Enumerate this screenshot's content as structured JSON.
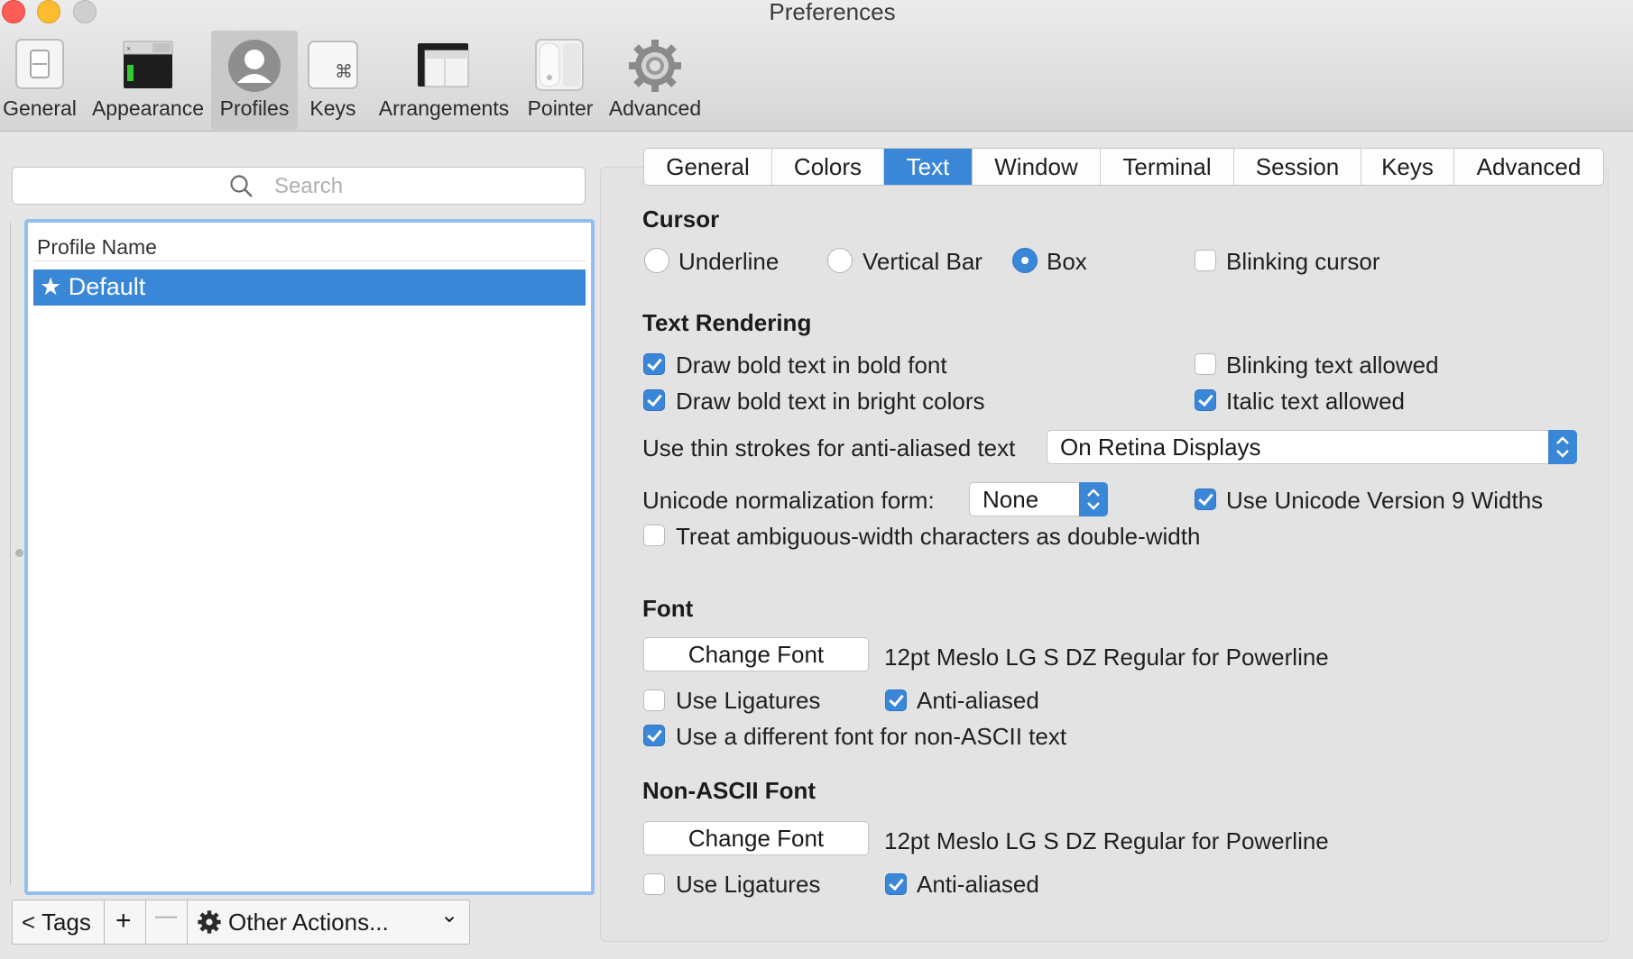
{
  "window": {
    "title": "Preferences"
  },
  "toolbar": {
    "items": [
      {
        "label": "General"
      },
      {
        "label": "Appearance"
      },
      {
        "label": "Profiles"
      },
      {
        "label": "Keys"
      },
      {
        "label": "Arrangements"
      },
      {
        "label": "Pointer"
      },
      {
        "label": "Advanced"
      }
    ],
    "selected": "Profiles"
  },
  "sidebar": {
    "search_placeholder": "Search",
    "table_header": "Profile Name",
    "profiles": [
      {
        "label": "★ Default",
        "selected": true
      }
    ],
    "bottom": {
      "tags": "< Tags",
      "add": "+",
      "remove": "—",
      "other_actions": "Other Actions...",
      "dropdown": "⌄"
    }
  },
  "tabs": [
    {
      "label": "General"
    },
    {
      "label": "Colors"
    },
    {
      "label": "Text",
      "active": true
    },
    {
      "label": "Window"
    },
    {
      "label": "Terminal"
    },
    {
      "label": "Session"
    },
    {
      "label": "Keys"
    },
    {
      "label": "Advanced"
    }
  ],
  "cursor": {
    "title": "Cursor",
    "options": {
      "underline": "Underline",
      "vertical_bar": "Vertical Bar",
      "box": "Box"
    },
    "selected": "Box",
    "blinking_label": "Blinking cursor",
    "blinking": false
  },
  "rendering": {
    "title": "Text Rendering",
    "bold_font": {
      "label": "Draw bold text in bold font",
      "checked": true
    },
    "bold_bright": {
      "label": "Draw bold text in bright colors",
      "checked": true
    },
    "blinking_text": {
      "label": "Blinking text allowed",
      "checked": false
    },
    "italic_text": {
      "label": "Italic text allowed",
      "checked": true
    },
    "thin_strokes_label": "Use thin strokes for anti-aliased text",
    "thin_strokes_value": "On Retina Displays",
    "normalization_label": "Unicode normalization form:",
    "normalization_value": "None",
    "unicode9": {
      "label": "Use Unicode Version 9 Widths",
      "checked": true
    },
    "ambiguous": {
      "label": "Treat ambiguous-width characters as double-width",
      "checked": false
    }
  },
  "font": {
    "title": "Font",
    "change_button": "Change Font",
    "description": "12pt Meslo LG S DZ Regular for Powerline",
    "ligatures": {
      "label": "Use Ligatures",
      "checked": false
    },
    "antialiased": {
      "label": "Anti-aliased",
      "checked": true
    },
    "non_ascii_toggle": {
      "label": "Use a different font for non-ASCII text",
      "checked": true
    }
  },
  "non_ascii_font": {
    "title": "Non-ASCII Font",
    "change_button": "Change Font",
    "description": "12pt Meslo LG S DZ Regular for Powerline",
    "ligatures": {
      "label": "Use Ligatures",
      "checked": false
    },
    "antialiased": {
      "label": "Anti-aliased",
      "checked": true
    }
  },
  "colors": {
    "accent": "#3a86d7",
    "selection_border": "#94bdf0"
  }
}
